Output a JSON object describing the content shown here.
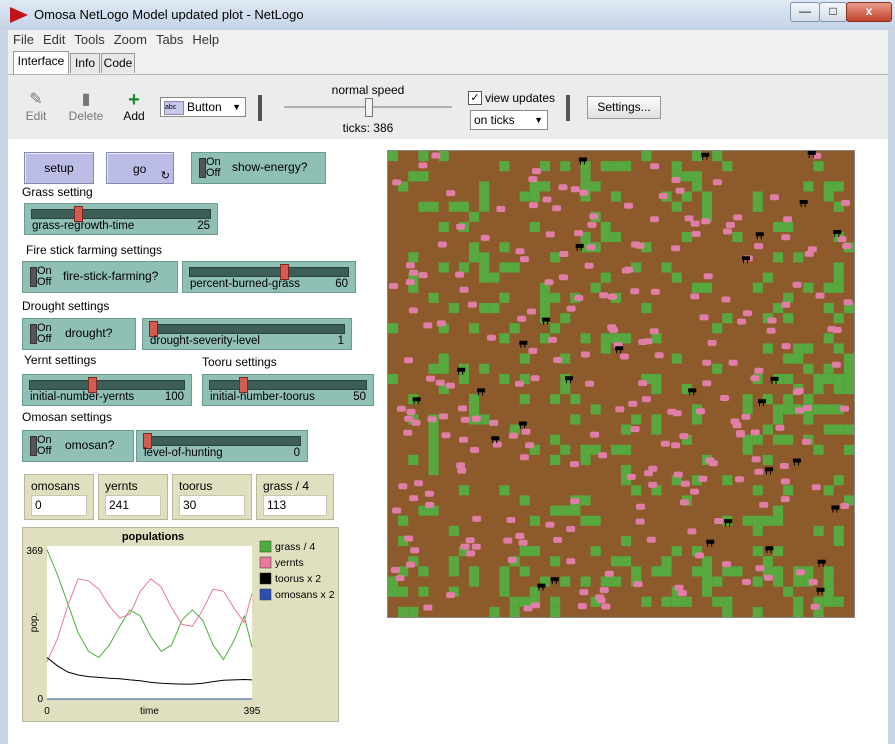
{
  "window": {
    "title": "Omosa NetLogo Model updated plot - NetLogo",
    "controls": [
      "—",
      "□",
      "x"
    ]
  },
  "menu": [
    "File",
    "Edit",
    "Tools",
    "Zoom",
    "Tabs",
    "Help"
  ],
  "tabs": [
    "Interface",
    "Info",
    "Code"
  ],
  "active_tab": "Interface",
  "toolbar": {
    "edit": "Edit",
    "delete": "Delete",
    "add": "Add",
    "widget_type": "Button",
    "speed_label": "normal speed",
    "speed": 0.5,
    "ticks_label": "ticks: 386",
    "view_updates_label": "view updates",
    "view_updates_checked": true,
    "update_mode": "on ticks",
    "settings": "Settings..."
  },
  "buttons": {
    "setup": "setup",
    "go": "go"
  },
  "switches": {
    "on": "On",
    "off": "Off",
    "show_energy": "show-energy?",
    "fire_stick": "fire-stick-farming?",
    "drought": "drought?",
    "omosan": "omosan?"
  },
  "notes": {
    "grass": "Grass setting",
    "fire": "Fire stick farming settings",
    "drought": "Drought settings",
    "yernt": "Yernt settings",
    "tooru": "Tooru settings",
    "omosan": "Omosan settings"
  },
  "sliders": [
    {
      "id": "grass",
      "name": "grass-regrowth-time",
      "value": "25",
      "fraction": 0.25
    },
    {
      "id": "burn",
      "name": "percent-burned-grass",
      "value": "60",
      "fraction": 0.6
    },
    {
      "id": "drought",
      "name": "drought-severity-level",
      "value": "1",
      "fraction": 0.0
    },
    {
      "id": "yernts",
      "name": "initial-number-yernts",
      "value": "100",
      "fraction": 0.4
    },
    {
      "id": "toorus",
      "name": "initial-number-toorus",
      "value": "50",
      "fraction": 0.2
    },
    {
      "id": "hunting",
      "name": "level-of-hunting",
      "value": "0",
      "fraction": 0.0
    }
  ],
  "monitors": [
    {
      "label": "omosans",
      "value": "0"
    },
    {
      "label": "yernts",
      "value": "241"
    },
    {
      "label": "toorus",
      "value": "30"
    },
    {
      "label": "grass / 4",
      "value": "113"
    }
  ],
  "chart_data": {
    "type": "line",
    "title": "populations",
    "xlabel": "time",
    "ylabel": "pop.",
    "xlim": [
      0,
      395
    ],
    "ylim": [
      0,
      369
    ],
    "xticks": [
      "0",
      "395"
    ],
    "yticks": [
      "0",
      "369"
    ],
    "grid": false,
    "legend_position": "right",
    "series": [
      {
        "name": "grass / 4",
        "color": "#4caf3c",
        "x": [
          0,
          20,
          40,
          60,
          80,
          100,
          120,
          140,
          160,
          180,
          200,
          220,
          240,
          260,
          280,
          300,
          320,
          340,
          360,
          380,
          395
        ],
        "y": [
          360,
          300,
          230,
          160,
          115,
          100,
          130,
          175,
          215,
          200,
          150,
          115,
          130,
          190,
          215,
          190,
          130,
          95,
          140,
          200,
          125
        ]
      },
      {
        "name": "yernts",
        "color": "#e87a9a",
        "x": [
          0,
          20,
          40,
          60,
          80,
          100,
          120,
          140,
          160,
          180,
          200,
          220,
          240,
          260,
          280,
          300,
          320,
          340,
          360,
          380,
          395
        ],
        "y": [
          90,
          145,
          225,
          290,
          285,
          265,
          225,
          195,
          205,
          260,
          290,
          270,
          220,
          180,
          175,
          215,
          265,
          260,
          220,
          185,
          255
        ]
      },
      {
        "name": "toorus x 2",
        "color": "#000000",
        "x": [
          0,
          20,
          40,
          60,
          80,
          100,
          120,
          140,
          160,
          180,
          200,
          220,
          240,
          260,
          280,
          300,
          320,
          340,
          360,
          380,
          395
        ],
        "y": [
          100,
          80,
          65,
          58,
          54,
          52,
          50,
          49,
          46,
          44,
          40,
          38,
          37,
          36,
          36,
          38,
          42,
          45,
          46,
          47,
          46
        ]
      },
      {
        "name": "omosans x 2",
        "color": "#2a4fb0",
        "x": [
          0,
          395
        ],
        "y": [
          0,
          0
        ]
      }
    ]
  },
  "world": {
    "background": "#8c5a2b",
    "grass_color": "#57a83e",
    "yernt_color": "#e07ea8",
    "tooru_color": "#000000"
  }
}
